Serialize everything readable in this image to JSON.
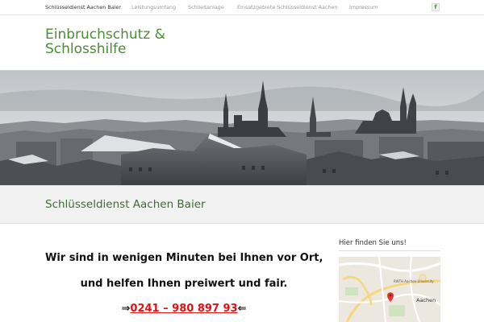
{
  "topnav": {
    "items": [
      {
        "label": "Schlüsseldienst Aachen Baier"
      },
      {
        "label": "Leistungsumfang"
      },
      {
        "label": "Schließanlage"
      },
      {
        "label": "Einsatzgebiete Schlüsseldienst Aachen"
      },
      {
        "label": "Impressum"
      }
    ],
    "facebook_icon": "facebook-icon",
    "facebook_glyph": "f"
  },
  "site": {
    "title_line1": "Einbruchschutz &",
    "title_line2": "Schlosshilfe"
  },
  "page": {
    "heading": "Schlüsseldienst Aachen Baier"
  },
  "content": {
    "line1": "Wir sind in wenigen Minuten bei Ihnen vor Ort,",
    "line2": "und helfen Ihnen preiwert und fair.",
    "arrow_left": "⇒",
    "phone": "0241 – 980 897 93",
    "arrow_right": "⇐"
  },
  "sidebar": {
    "widget_title": "Hier finden Sie uns!",
    "map_label": "Aachen",
    "map_poi": "RWTH Aachen University"
  },
  "colors": {
    "brand_green": "#4c8a35",
    "heading_green": "#3c6e2e",
    "phone_red": "#e01212"
  }
}
